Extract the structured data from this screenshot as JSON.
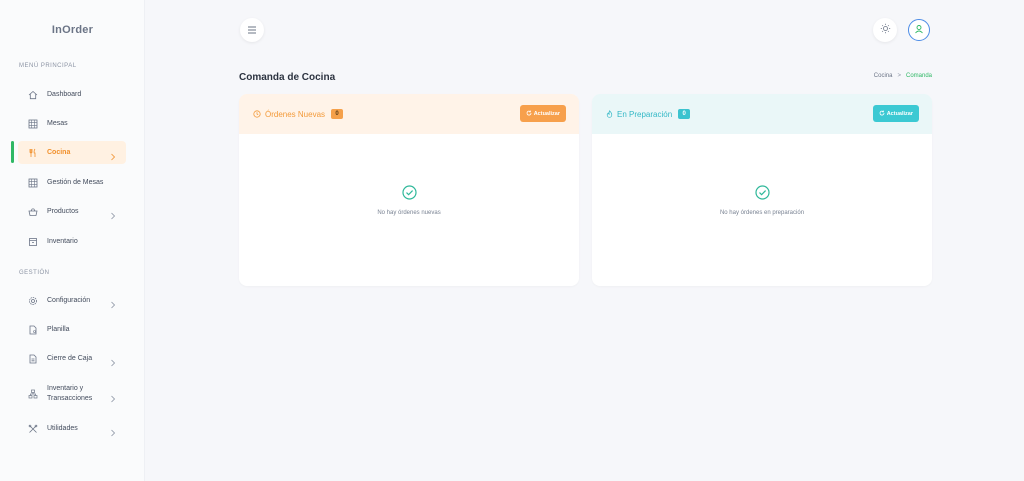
{
  "brand": "InOrder",
  "sidebar": {
    "section_main": "MENÚ PRINCIPAL",
    "section_manage": "GESTIÓN",
    "items": [
      {
        "label": "Dashboard",
        "icon": "home-icon"
      },
      {
        "label": "Mesas",
        "icon": "grid-icon"
      },
      {
        "label": "Cocina",
        "icon": "utensils-icon",
        "active": true
      },
      {
        "label": "Gestión de Mesas",
        "icon": "grid-icon"
      },
      {
        "label": "Productos",
        "icon": "basket-icon"
      },
      {
        "label": "Inventario",
        "icon": "box-icon"
      },
      {
        "label": "Configuración",
        "icon": "gear-icon"
      },
      {
        "label": "Planilla",
        "icon": "document-user-icon"
      },
      {
        "label": "Cierre de Caja",
        "icon": "document-icon"
      },
      {
        "label": "Inventario y\nTransacciones",
        "icon": "network-icon"
      },
      {
        "label": "Utilidades",
        "icon": "tools-icon"
      }
    ]
  },
  "header": {
    "menu_icon": "hamburger-icon",
    "theme_icon": "sun-icon",
    "user_icon": "user-icon"
  },
  "page": {
    "title": "Comanda de Cocina",
    "breadcrumb": {
      "parent": "Cocina",
      "separator": ">",
      "current": "Comanda"
    }
  },
  "cards": {
    "new_orders": {
      "title": "Órdenes Nuevas",
      "count": "0",
      "refresh_label": "Actualizar",
      "empty_message": "No hay órdenes nuevas",
      "accent": "#f5a04a"
    },
    "in_preparation": {
      "title": "En Preparación",
      "count": "0",
      "refresh_label": "Actualizar",
      "empty_message": "No hay órdenes en preparación",
      "accent": "#3cc9d3"
    }
  },
  "colors": {
    "active_bar": "#2fb865",
    "active_text": "#f1902c",
    "breadcrumb_current": "#2fb865",
    "check": "#2fb89a"
  }
}
